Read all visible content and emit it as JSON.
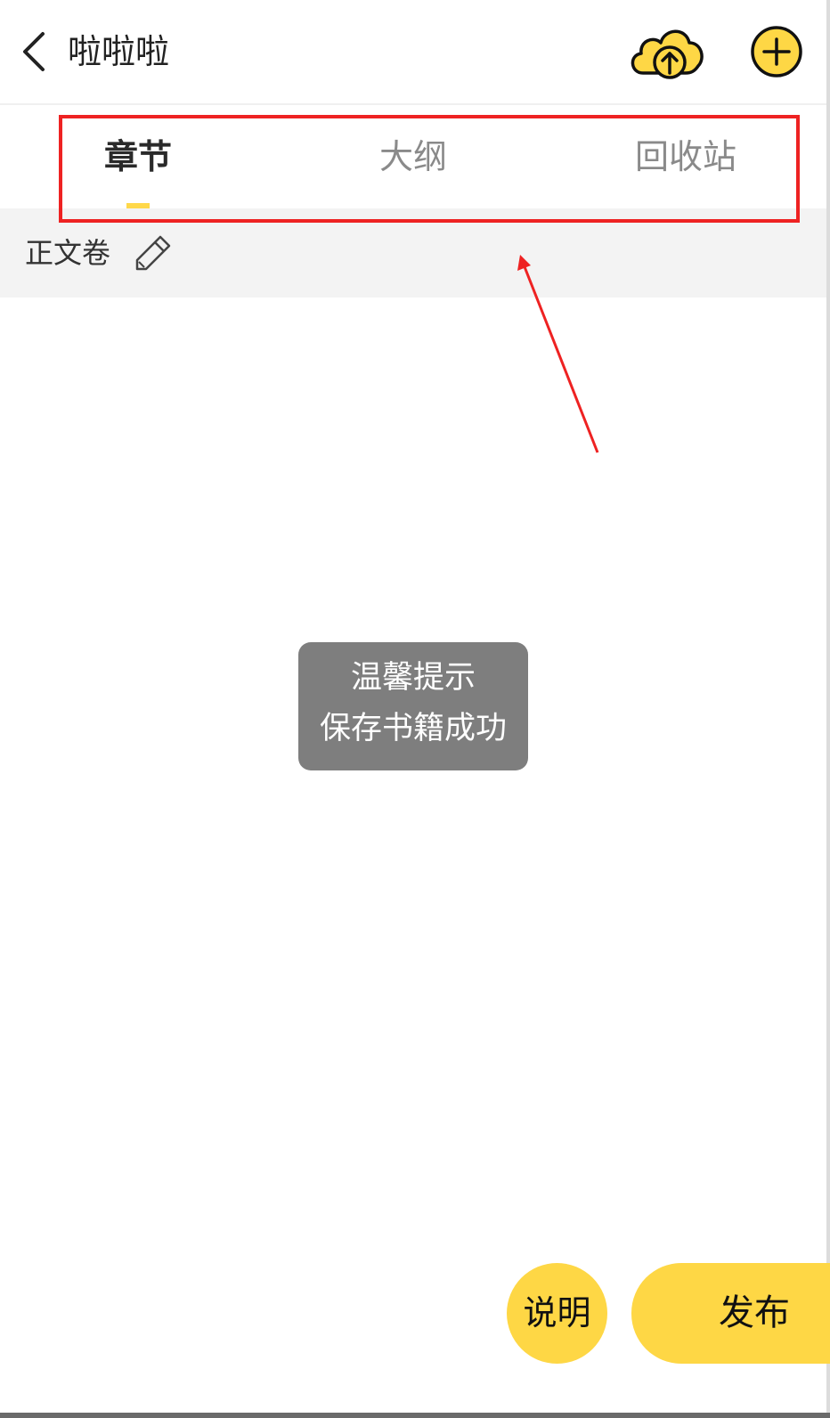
{
  "header": {
    "title": "啦啦啦",
    "back_icon": "chevron-left-icon",
    "upload_icon": "cloud-upload-icon",
    "add_icon": "plus-circle-icon",
    "accent_color": "#FED745"
  },
  "tabs": [
    {
      "label": "章节",
      "active": true
    },
    {
      "label": "大纲",
      "active": false
    },
    {
      "label": "回收站",
      "active": false
    }
  ],
  "volume": {
    "label": "正文卷",
    "edit_icon": "pencil-icon"
  },
  "toast": {
    "title": "温馨提示",
    "message": "保存书籍成功"
  },
  "actions": {
    "explain_label": "说明",
    "publish_label": "发布"
  },
  "annotation": {
    "color": "#EE2222"
  }
}
